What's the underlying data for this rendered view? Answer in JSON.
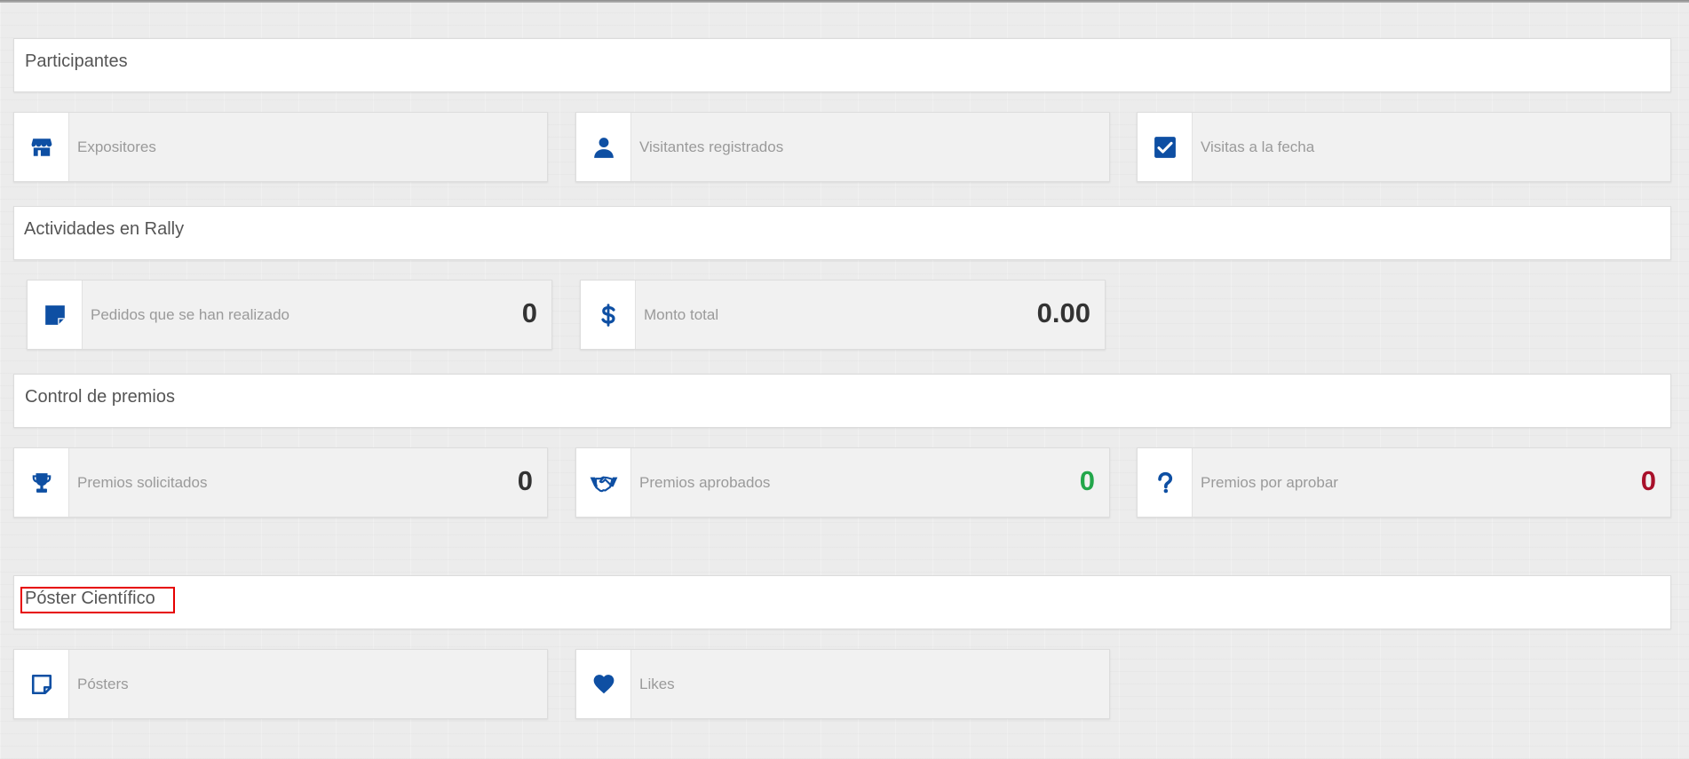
{
  "colors": {
    "icon": "#0e4fa3",
    "value_default": "#333333",
    "value_approved": "#22a64a",
    "value_pending": "#a8102a",
    "highlight": "#e60000"
  },
  "sections": {
    "participantes": {
      "title": "Participantes",
      "cards": {
        "expositores": {
          "label": "Expositores",
          "icon": "store-icon"
        },
        "visitantes": {
          "label": "Visitantes registrados",
          "icon": "user-icon"
        },
        "visitas": {
          "label": "Visitas a la fecha",
          "icon": "checkbox-icon"
        }
      }
    },
    "rally": {
      "title": "Actividades en Rally",
      "cards": {
        "pedidos": {
          "label": "Pedidos que se han realizado",
          "value": "0",
          "icon": "note-icon"
        },
        "monto": {
          "label": "Monto total",
          "value": "0.00",
          "icon": "dollar-icon"
        }
      }
    },
    "premios": {
      "title": "Control de premios",
      "cards": {
        "solicitados": {
          "label": "Premios solicitados",
          "value": "0",
          "icon": "trophy-icon"
        },
        "aprobados": {
          "label": "Premios aprobados",
          "value": "0",
          "icon": "handshake-icon"
        },
        "por_aprobar": {
          "label": "Premios por aprobar",
          "value": "0",
          "icon": "question-icon"
        }
      }
    },
    "poster": {
      "title": "Póster Científico",
      "cards": {
        "posters": {
          "label": "Pósters",
          "icon": "sticky-note-icon"
        },
        "likes": {
          "label": "Likes",
          "icon": "heart-icon"
        }
      }
    }
  }
}
